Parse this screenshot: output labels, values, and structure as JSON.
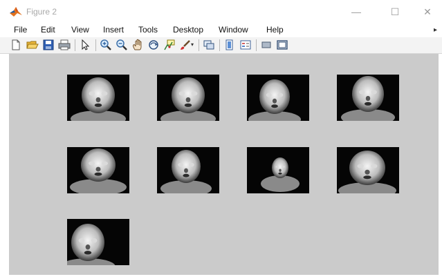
{
  "window": {
    "title": "Figure 2",
    "minimize_glyph": "—",
    "maximize_glyph": "☐",
    "close_glyph": "✕"
  },
  "menu": {
    "items": [
      "File",
      "Edit",
      "View",
      "Insert",
      "Tools",
      "Desktop",
      "Window",
      "Help"
    ],
    "overflow_glyph": "▸"
  },
  "toolbar": {
    "buttons": [
      "new-figure-icon",
      "open-file-icon",
      "save-icon",
      "print-icon",
      "edit-plot-arrow-icon",
      "zoom-in-icon",
      "zoom-out-icon",
      "pan-hand-icon",
      "rotate-3d-icon",
      "data-cursor-icon",
      "brush-icon",
      "link-plot-icon",
      "colorbar-icon",
      "legend-icon",
      "hide-plot-tools-icon",
      "show-plot-tools-icon"
    ]
  },
  "figure": {
    "background_color": "#cbcbcb",
    "image_count": 9,
    "images": [
      {
        "label": "thermal-face-1"
      },
      {
        "label": "thermal-face-2"
      },
      {
        "label": "thermal-face-3"
      },
      {
        "label": "thermal-face-4"
      },
      {
        "label": "thermal-face-5"
      },
      {
        "label": "thermal-face-6"
      },
      {
        "label": "thermal-face-7"
      },
      {
        "label": "thermal-face-8"
      },
      {
        "label": "thermal-face-9"
      }
    ]
  }
}
